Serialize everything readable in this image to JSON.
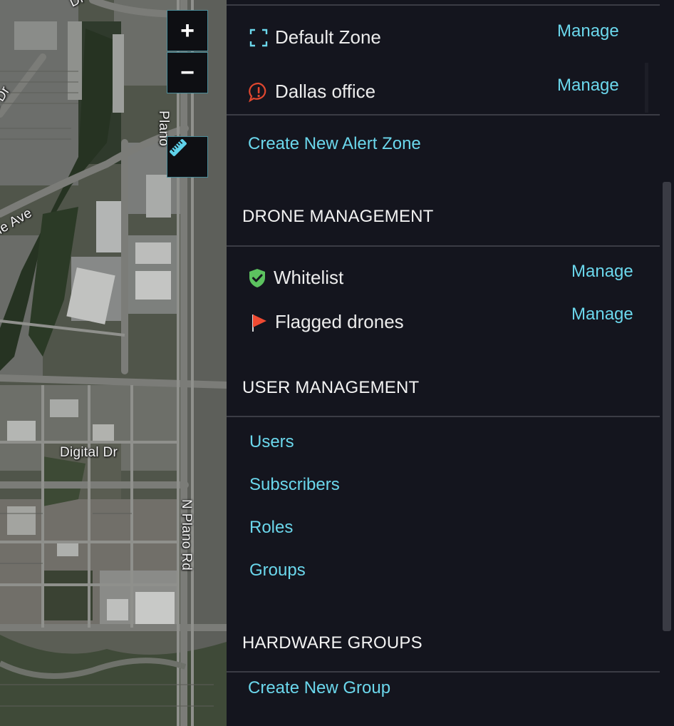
{
  "map": {
    "road_labels": {
      "top_dr": "Dr",
      "left_dr": "le Dr",
      "ave": "le Ave",
      "plano_top": "Plano",
      "digital_dr": "Digital Dr",
      "n_plano_rd": "N Plano Rd"
    },
    "controls": {
      "zoom_in": "+",
      "zoom_out": "−"
    }
  },
  "alert_zones": {
    "items": [
      {
        "label": "Default Zone",
        "icon": "dashed-square-icon",
        "action": "Manage"
      },
      {
        "label": "Dallas office",
        "icon": "alert-speech-icon",
        "action": "Manage"
      }
    ],
    "create_link": "Create New Alert Zone"
  },
  "drone_management": {
    "title": "DRONE MANAGEMENT",
    "items": [
      {
        "label": "Whitelist",
        "icon": "shield-check-icon",
        "action": "Manage"
      },
      {
        "label": "Flagged drones",
        "icon": "red-flag-icon",
        "action": "Manage"
      }
    ]
  },
  "user_management": {
    "title": "USER MANAGEMENT",
    "links": [
      "Users",
      "Subscribers",
      "Roles",
      "Groups"
    ]
  },
  "hardware_groups": {
    "title": "HARDWARE GROUPS",
    "create_link": "Create New Group"
  },
  "colors": {
    "panel_bg": "#14151e",
    "link": "#6bd7ec",
    "divider": "#3b3c45",
    "alert_red": "#e0472f",
    "shield_green": "#5cc25f",
    "flag_red": "#f04a32"
  }
}
